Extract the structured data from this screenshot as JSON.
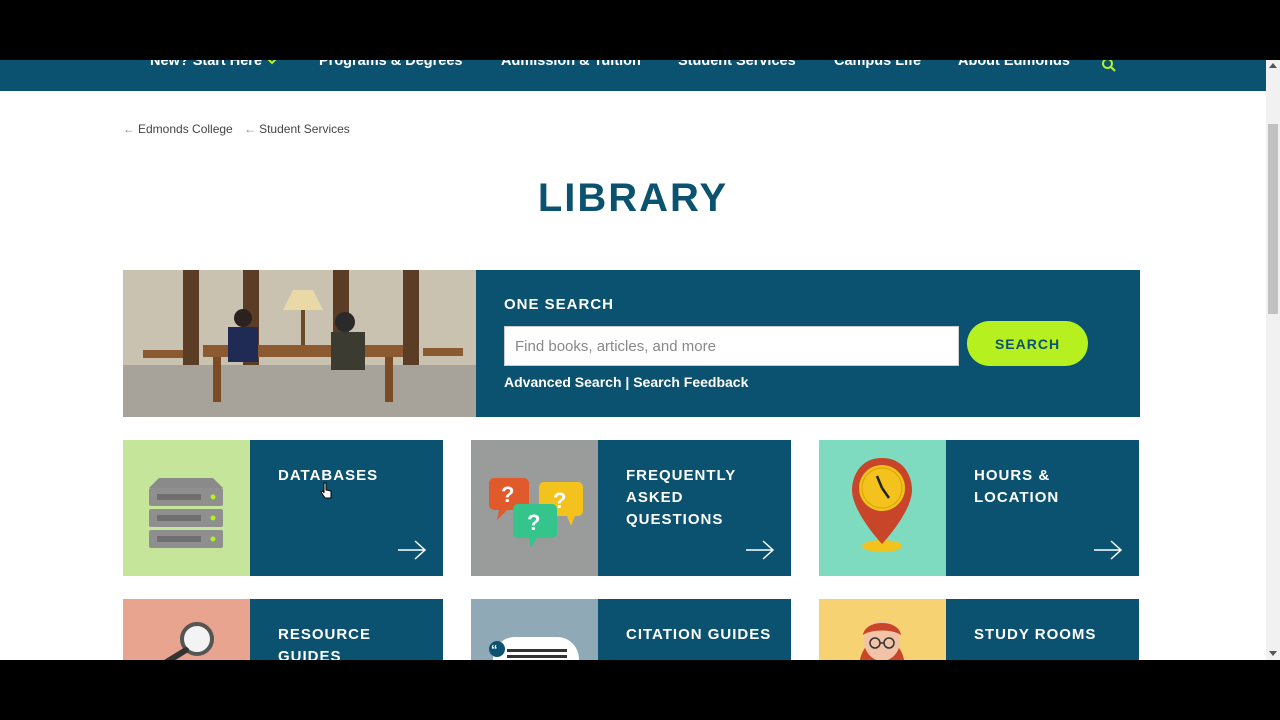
{
  "nav": {
    "items": [
      "New? Start Here",
      "Programs & Degrees",
      "Admission & Tuition",
      "Student Services",
      "Campus Life",
      "About Edmonds"
    ],
    "search_icon": "search-icon"
  },
  "breadcrumb": [
    "Edmonds College",
    "Student Services"
  ],
  "page_title": "LIBRARY",
  "one_search": {
    "label": "ONE SEARCH",
    "placeholder": "Find books, articles, and more",
    "button": "SEARCH",
    "advanced_link": "Advanced Search",
    "separator": "|",
    "feedback_link": "Search Feedback"
  },
  "cards": [
    {
      "title": "DATABASES",
      "icon": "server-icon",
      "icon_bg": "#c4e59a"
    },
    {
      "title": "FREQUENTLY ASKED QUESTIONS",
      "icon": "question-bubbles-icon",
      "icon_bg": "#9a9c9b"
    },
    {
      "title": "HOURS & LOCATION",
      "icon": "clock-pin-icon",
      "icon_bg": "#7fdbbf"
    },
    {
      "title": "RESOURCE GUIDES",
      "icon": "magnifier-icon",
      "icon_bg": "#e8a48e"
    },
    {
      "title": "CITATION GUIDES",
      "icon": "quote-doc-icon",
      "icon_bg": "#8faab6"
    },
    {
      "title": "STUDY ROOMS",
      "icon": "person-icon",
      "icon_bg": "#f7d272"
    }
  ],
  "colors": {
    "brand": "#0b5271",
    "accent": "#b7f01f"
  }
}
